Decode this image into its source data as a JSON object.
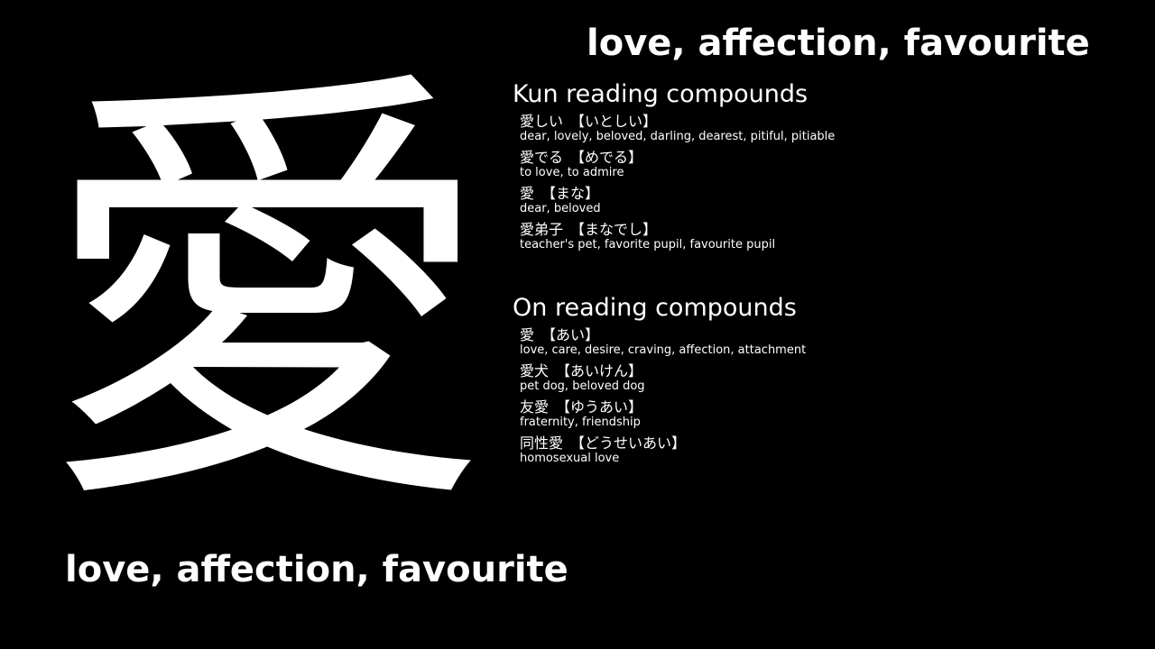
{
  "meaning": "love, affection, favourite",
  "kanji": "愛",
  "kun": {
    "title": "Kun reading compounds",
    "items": [
      {
        "word": "愛しい",
        "reading": "【いとしい】",
        "meaning": "dear, lovely, beloved, darling, dearest, pitiful, pitiable"
      },
      {
        "word": "愛でる",
        "reading": "【めでる】",
        "meaning": "to love, to admire"
      },
      {
        "word": "愛",
        "reading": "【まな】",
        "meaning": "dear, beloved"
      },
      {
        "word": "愛弟子",
        "reading": "【まなでし】",
        "meaning": "teacher's pet, favorite pupil, favourite pupil"
      }
    ]
  },
  "on": {
    "title": "On reading compounds",
    "items": [
      {
        "word": "愛",
        "reading": "【あい】",
        "meaning": "love, care, desire, craving, affection, attachment"
      },
      {
        "word": "愛犬",
        "reading": "【あいけん】",
        "meaning": "pet dog, beloved dog"
      },
      {
        "word": "友愛",
        "reading": "【ゆうあい】",
        "meaning": "fraternity, friendship"
      },
      {
        "word": "同性愛",
        "reading": "【どうせいあい】",
        "meaning": "homosexual love"
      }
    ]
  },
  "colors": {
    "background": "#000000",
    "text": "#ffffff"
  }
}
